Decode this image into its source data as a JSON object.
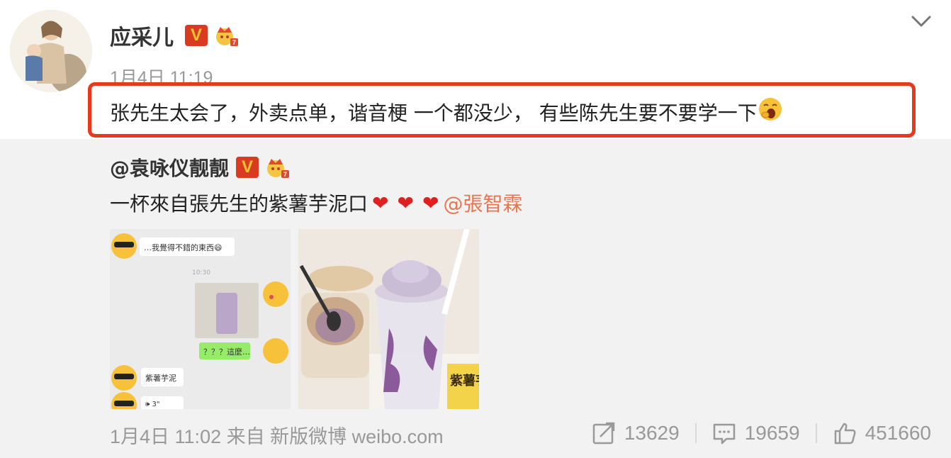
{
  "post": {
    "author": "应采儿",
    "time": "1月4日 11:19",
    "text": "张先生太会了，外卖点单，谐音梗 一个都没少， 有些陈先生要不要学一下"
  },
  "badges": {
    "v": "V"
  },
  "repost": {
    "author": "@袁咏仪靓靓",
    "text": "一杯來自張先生的紫薯芋泥",
    "box_char": "口",
    "hearts": [
      "❤",
      "❤",
      "❤"
    ],
    "mention": "@張智霖",
    "pic1": {
      "msg1": "…我覺得不錯的東西😄",
      "time": "10:30",
      "msg2": "？？？這麼…",
      "msg3": "紫薯芋泥",
      "msg4": "🕪 3\""
    },
    "pic2": {
      "sticker": "紫薯芋泥"
    },
    "footer": "1月4日 11:02 来自 新版微博 weibo.com",
    "actions": {
      "reposts": "13629",
      "comments": "19659",
      "likes": "451660"
    }
  },
  "colors": {
    "highlight": "#e8391d",
    "mention": "#eb7350",
    "v_badge": "#d83b1f"
  }
}
